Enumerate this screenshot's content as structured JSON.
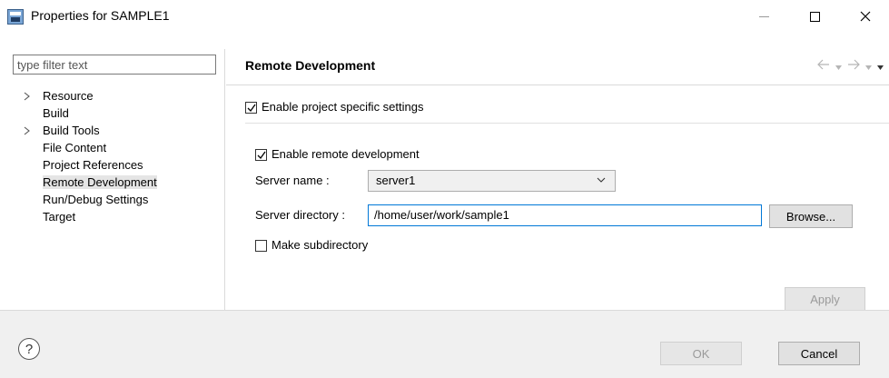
{
  "window": {
    "title": "Properties for SAMPLE1"
  },
  "icons": {
    "app": "eclipse-properties-icon",
    "minimize": "minimize-icon",
    "maximize": "maximize-icon",
    "close": "close-icon",
    "help": "help-icon"
  },
  "sidebar": {
    "filter_placeholder": "type filter text",
    "items": [
      {
        "label": "Resource",
        "expandable": true
      },
      {
        "label": "Build",
        "expandable": false
      },
      {
        "label": "Build Tools",
        "expandable": true
      },
      {
        "label": "File Content",
        "expandable": false
      },
      {
        "label": "Project References",
        "expandable": false
      },
      {
        "label": "Remote Development",
        "expandable": false,
        "selected": true
      },
      {
        "label": "Run/Debug Settings",
        "expandable": false
      },
      {
        "label": "Target",
        "expandable": false
      }
    ]
  },
  "page": {
    "title": "Remote Development",
    "enable_project_specific": {
      "label": "Enable project specific settings",
      "checked": true
    },
    "enable_remote": {
      "label": "Enable remote development",
      "checked": true
    },
    "server_name": {
      "label": "Server name :",
      "value": "server1"
    },
    "server_directory": {
      "label": "Server directory :",
      "value": "/home/user/work/sample1"
    },
    "browse_label": "Browse...",
    "make_subdirectory": {
      "label": "Make subdirectory",
      "checked": false
    },
    "apply_label": "Apply"
  },
  "footer": {
    "help_glyph": "?",
    "ok_label": "OK",
    "cancel_label": "Cancel"
  }
}
